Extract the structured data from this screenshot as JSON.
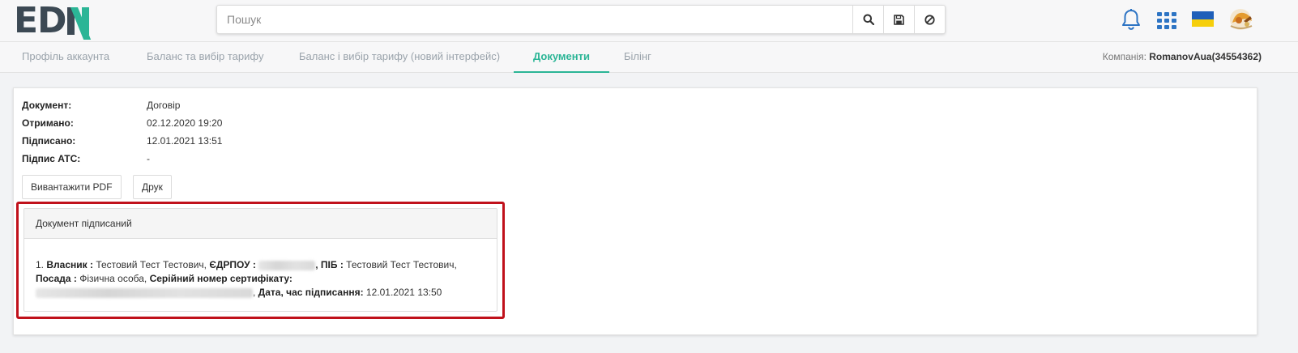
{
  "header": {
    "logo_text": "EDIN",
    "search_placeholder": "Пошук",
    "search_icon": "search-icon",
    "save_icon": "save-icon",
    "clear_icon": "ban-icon",
    "bell_icon": "bell-icon",
    "apps_icon": "apps-grid-icon",
    "flag": {
      "name": "ukraine-flag",
      "colors": [
        "#1f5fb9",
        "#f6cf0c"
      ]
    },
    "avatar_icon": "user-avatar"
  },
  "tabs": [
    {
      "label": "Профіль аккаунта",
      "active": false
    },
    {
      "label": "Баланс та вибір тарифу",
      "active": false
    },
    {
      "label": "Баланс і вибір тарифу (новий інтерфейс)",
      "active": false
    },
    {
      "label": "Документи",
      "active": true
    },
    {
      "label": "Білінг",
      "active": false
    }
  ],
  "company": {
    "label": "Компанія:",
    "value": "RomanovAua(34554362)"
  },
  "document": {
    "rows": [
      {
        "key": "Документ:",
        "value": "Договір"
      },
      {
        "key": "Отримано:",
        "value": "02.12.2020 19:20"
      },
      {
        "key": "Підписано:",
        "value": "12.01.2021 13:51"
      },
      {
        "key": "Підпис АТС:",
        "value": "-"
      }
    ],
    "buttons": {
      "download_pdf": "Вивантажити PDF",
      "print": "Друк"
    }
  },
  "signature_panel": {
    "title": "Документ підписаний",
    "entry": {
      "index": "1.",
      "owner_label": "Власник :",
      "owner_value": "Тестовий Тест Тестович,",
      "edrpou_label": "ЄДРПОУ :",
      "pib_label": "ПІБ :",
      "pib_value": "Тестовий Тест Тестович,",
      "position_label": "Посада :",
      "position_value": "Фізична особа,",
      "serial_label": "Серійний номер сертифікату:",
      "date_label": "Дата, час підписання:",
      "date_value": "12.01.2021 13:50"
    }
  },
  "colors": {
    "accent": "#2bb596",
    "highlight": "#c0111b"
  }
}
